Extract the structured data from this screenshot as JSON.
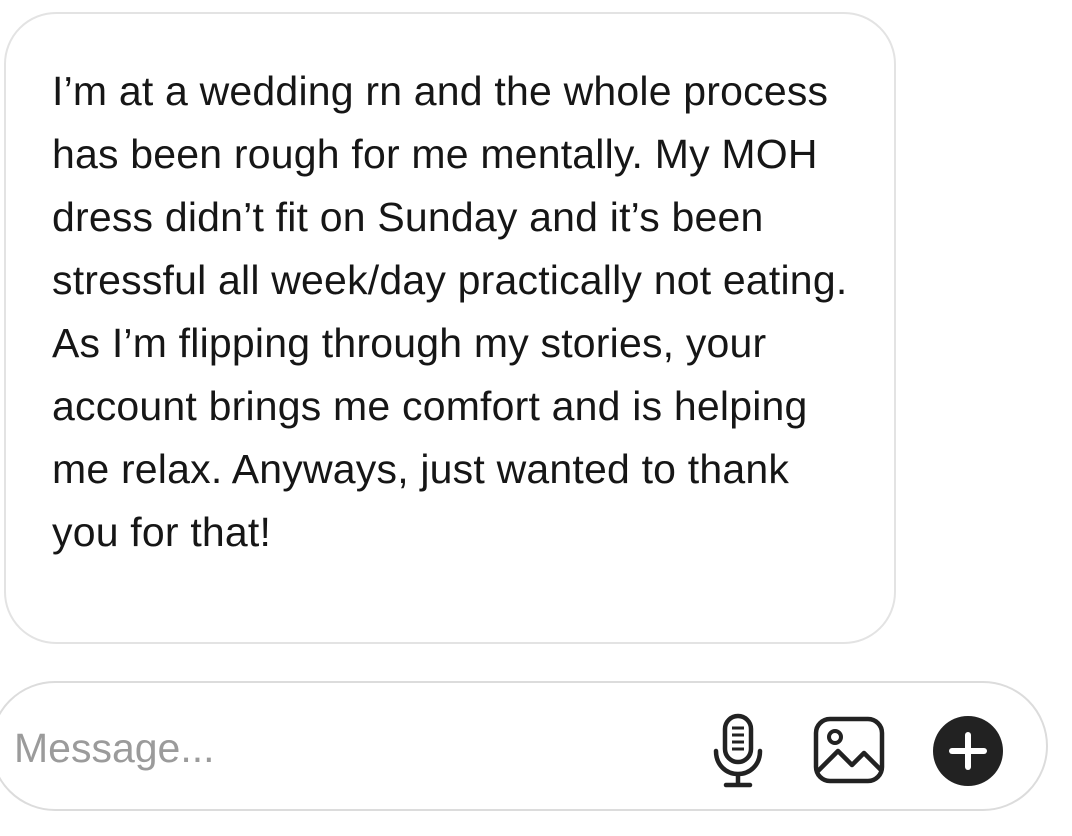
{
  "message": {
    "text": "I’m at a wedding rn and the whole process has been rough for me mentally. My MOH dress didn’t fit on Sunday and it’s been stressful all week/day practically not eating. As I’m flipping through my stories, your account brings me comfort and is helping me relax. Anyways, just wanted to thank you for that!"
  },
  "composer": {
    "placeholder": "Message...",
    "icons": [
      "microphone-icon",
      "image-icon",
      "plus-icon"
    ]
  },
  "colors": {
    "bubble_border": "#e3e3e3",
    "placeholder": "#9b9b9b",
    "plus_button": "#222222"
  }
}
